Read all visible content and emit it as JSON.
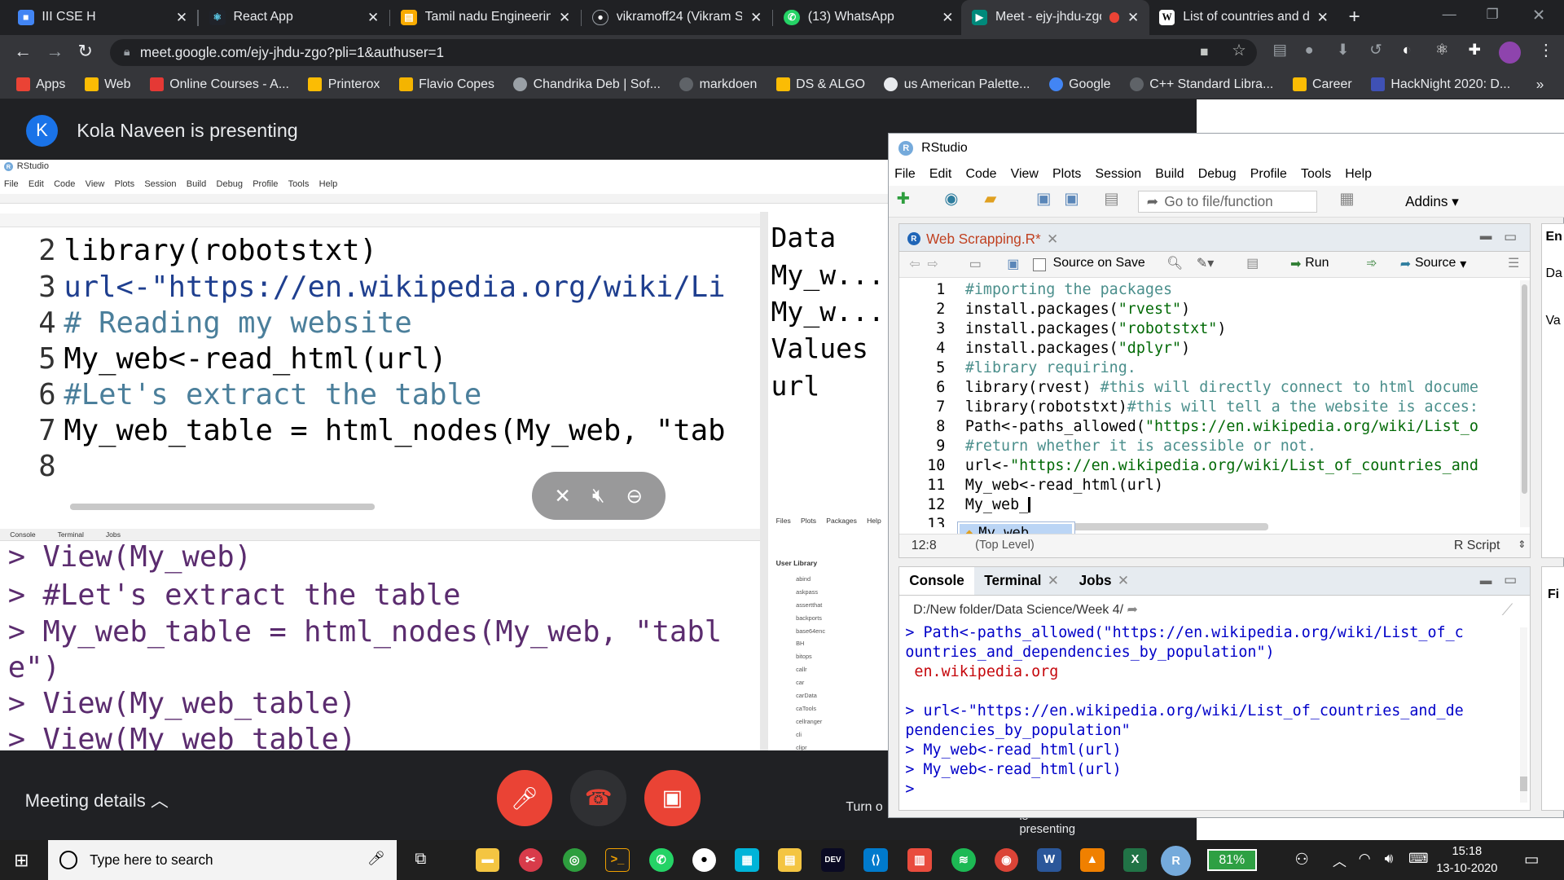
{
  "browser": {
    "tabs": [
      {
        "title": "III CSE H",
        "icon_color": "#4285f4"
      },
      {
        "title": "React App",
        "icon_color": "#61dafb"
      },
      {
        "title": "Tamil nadu Engineering",
        "icon_color": "#f9ab00"
      },
      {
        "title": "vikramoff24 (Vikram S)",
        "icon_color": "#ffffff"
      },
      {
        "title": "(13) WhatsApp",
        "icon_color": "#25d366"
      },
      {
        "title": "Meet - ejy-jhdu-zgo",
        "icon_color": "#00897b"
      },
      {
        "title": "List of countries and de",
        "icon_color": "#ffffff"
      }
    ],
    "url": "meet.google.com/ejy-jhdu-zgo?pli=1&authuser=1",
    "bookmarks": [
      {
        "label": "Apps",
        "color": "#ea4335"
      },
      {
        "label": "Web",
        "color": "#fbbc04"
      },
      {
        "label": "Online Courses - A...",
        "color": "#e53935"
      },
      {
        "label": "Printerox",
        "color": "#fbbc04"
      },
      {
        "label": "Flavio Copes",
        "color": "#f4b400"
      },
      {
        "label": "Chandrika Deb | Sof...",
        "color": "#9aa0a6"
      },
      {
        "label": "markdoen",
        "color": "#5f6368"
      },
      {
        "label": "DS & ALGO",
        "color": "#fbbc04"
      },
      {
        "label": "us American Palette...",
        "color": "#e8eaed"
      },
      {
        "label": "Google",
        "color": "#4285f4"
      },
      {
        "label": "C++ Standard Libra...",
        "color": "#5f6368"
      },
      {
        "label": "Career",
        "color": "#fbbc04"
      },
      {
        "label": "HackNight 2020: D...",
        "color": "#3f51b5"
      }
    ]
  },
  "meet": {
    "avatar_letter": "K",
    "presenting": "Kola Naveen is presenting",
    "meeting_details": "Meeting details",
    "turn_on": "Turn o",
    "presenting_small": "is presenting",
    "shared_screen": {
      "app_title": "RStudio",
      "menu": [
        "File",
        "Edit",
        "Code",
        "View",
        "Plots",
        "Session",
        "Build",
        "Debug",
        "Profile",
        "Tools",
        "Help"
      ],
      "code_lines": [
        {
          "n": "2",
          "text": "library(robotstxt)",
          "kind": "plain"
        },
        {
          "n": "3",
          "text": "url<-\"https://en.wikipedia.org/wiki/Li",
          "kind": "url"
        },
        {
          "n": "4",
          "text": "# Reading my website",
          "kind": "comment"
        },
        {
          "n": "5",
          "text": "My_web<-read_html(url)",
          "kind": "plain"
        },
        {
          "n": "6",
          "text": "#Let's extract the table",
          "kind": "comment"
        },
        {
          "n": "7",
          "text": "My_web_table = html_nodes(My_web, \"tab",
          "kind": "plain"
        },
        {
          "n": "8",
          "text": "",
          "kind": "plain"
        }
      ],
      "console_lines": [
        "> View(My_web)",
        "> #Let's extract the table",
        "> My_web_table = html_nodes(My_web, \"tabl",
        "e\")",
        "> View(My_web_table)",
        "> View(My_web_table)"
      ],
      "env_items": [
        "Data",
        " My_w...",
        " My_w...",
        "Values",
        " url"
      ],
      "pane_tabs": [
        "Console",
        "Terminal",
        "Jobs"
      ],
      "files_tabs": [
        "Files",
        "Plots",
        "Packages",
        "Help"
      ],
      "user_library": "User Library",
      "packages": [
        "abind",
        "askpass",
        "assertthat",
        "backports",
        "base64enc",
        "BH",
        "bitops",
        "callr",
        "car",
        "carData",
        "caTools",
        "cellranger",
        "cli",
        "clipr"
      ]
    }
  },
  "rstudio": {
    "title": "RStudio",
    "menu": [
      "File",
      "Edit",
      "Code",
      "View",
      "Plots",
      "Session",
      "Build",
      "Debug",
      "Profile",
      "Tools",
      "Help"
    ],
    "goto_file": "Go to file/function",
    "addins": "Addins",
    "file_tab": "Web Scrapping.R*",
    "source_on_save": "Source on Save",
    "run": "Run",
    "source": "Source",
    "lines": [
      {
        "n": "1",
        "parts": [
          {
            "t": "#importing the packages",
            "k": "cm"
          }
        ]
      },
      {
        "n": "2",
        "parts": [
          {
            "t": "install.packages(",
            "k": "kw"
          },
          {
            "t": "\"rvest\"",
            "k": "st"
          },
          {
            "t": ")",
            "k": "kw"
          }
        ]
      },
      {
        "n": "3",
        "parts": [
          {
            "t": "install.packages(",
            "k": "kw"
          },
          {
            "t": "\"robotstxt\"",
            "k": "st"
          },
          {
            "t": ")",
            "k": "kw"
          }
        ]
      },
      {
        "n": "4",
        "parts": [
          {
            "t": "install.packages(",
            "k": "kw"
          },
          {
            "t": "\"dplyr\"",
            "k": "st"
          },
          {
            "t": ")",
            "k": "kw"
          }
        ]
      },
      {
        "n": "5",
        "parts": [
          {
            "t": "#library requiring.",
            "k": "cm"
          }
        ]
      },
      {
        "n": "6",
        "parts": [
          {
            "t": "library(rvest) ",
            "k": "kw"
          },
          {
            "t": "#this will directly connect to html docume",
            "k": "cm"
          }
        ]
      },
      {
        "n": "7",
        "parts": [
          {
            "t": "library(robotstxt)",
            "k": "kw"
          },
          {
            "t": "#this will tell a the website is acces:",
            "k": "cm"
          }
        ]
      },
      {
        "n": "8",
        "parts": [
          {
            "t": "Path<-paths_allowed(",
            "k": "kw"
          },
          {
            "t": "\"https://en.wikipedia.org/wiki/List_o",
            "k": "st"
          }
        ]
      },
      {
        "n": "9",
        "parts": [
          {
            "t": "#return whether it is acessible or not.",
            "k": "cm"
          }
        ]
      },
      {
        "n": "10",
        "parts": [
          {
            "t": "url<-",
            "k": "kw"
          },
          {
            "t": "\"https://en.wikipedia.org/wiki/List_of_countries_and",
            "k": "st"
          }
        ]
      },
      {
        "n": "11",
        "parts": [
          {
            "t": "My_web<-read_html(url)",
            "k": "kw"
          }
        ]
      },
      {
        "n": "12",
        "parts": [
          {
            "t": "My_web_",
            "k": "kw"
          }
        ]
      },
      {
        "n": "13",
        "parts": [
          {
            "t": "",
            "k": "kw"
          }
        ]
      }
    ],
    "autocomplete": "My_web",
    "cursor_pos": "12:8",
    "top_level": "(Top Level)",
    "script_type": "R Script",
    "console_tabs": [
      "Console",
      "Terminal",
      "Jobs"
    ],
    "working_dir": "D:/New folder/Data Science/Week 4/",
    "console": [
      {
        "t": "> Path<-paths_allowed(\"https://en.wikipedia.org/wiki/List_of_c",
        "k": "in"
      },
      {
        "t": "ountries_and_dependencies_by_population\")",
        "k": "in"
      },
      {
        "t": " en.wikipedia.org",
        "k": "out"
      },
      {
        "t": "",
        "k": "in"
      },
      {
        "t": "> url<-\"https://en.wikipedia.org/wiki/List_of_countries_and_de",
        "k": "in"
      },
      {
        "t": "pendencies_by_population\"",
        "k": "in"
      },
      {
        "t": "> My_web<-read_html(url)",
        "k": "in"
      },
      {
        "t": "> My_web<-read_html(url)",
        "k": "in"
      },
      {
        "t": ">",
        "k": "in"
      }
    ],
    "right_labels": [
      "En",
      "Da",
      "Va",
      "Fi"
    ]
  },
  "taskbar": {
    "search_placeholder": "Type here to search",
    "battery": "81%",
    "time": "15:18",
    "date": "13-10-2020"
  }
}
